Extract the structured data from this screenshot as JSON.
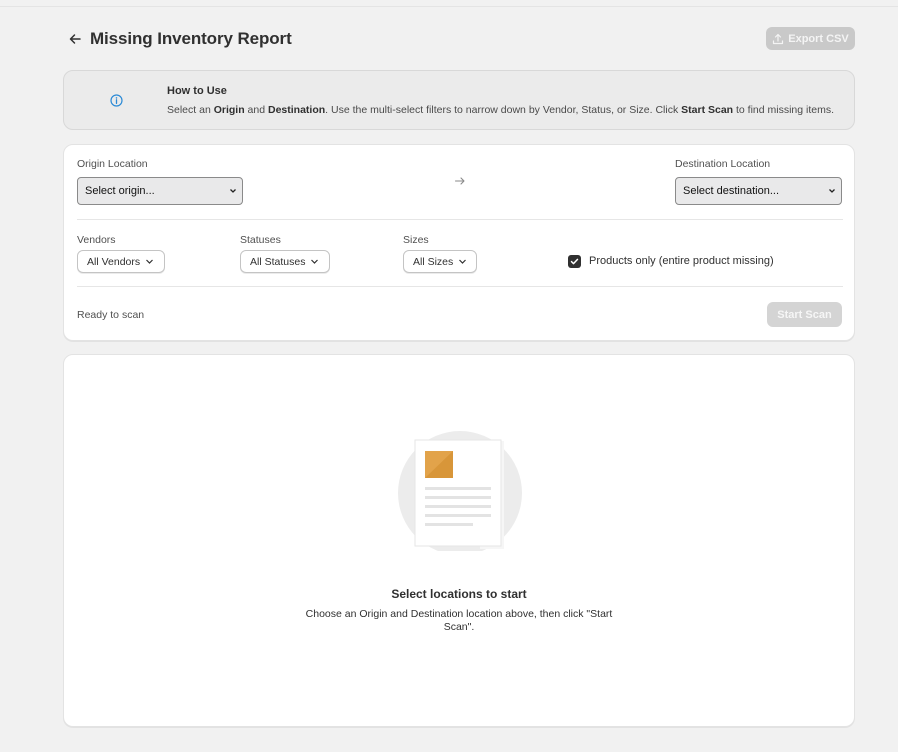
{
  "header": {
    "title": "Missing Inventory Report",
    "export_label": "Export CSV"
  },
  "info": {
    "title": "How to Use",
    "text_parts": [
      "Select an ",
      "Origin",
      " and ",
      "Destination",
      ". Use the multi-select filters to narrow down by Vendor, Status, or Size. Click ",
      "Start Scan",
      " to find missing items."
    ]
  },
  "filters": {
    "origin_label": "Origin Location",
    "origin_value": "Select origin...",
    "destination_label": "Destination Location",
    "destination_value": "Select destination...",
    "vendors_label": "Vendors",
    "vendors_value": "All Vendors",
    "statuses_label": "Statuses",
    "statuses_value": "All Statuses",
    "sizes_label": "Sizes",
    "sizes_value": "All Sizes",
    "products_only_label": "Products only (entire product missing)",
    "products_only_checked": true
  },
  "scan": {
    "status": "Ready to scan",
    "button_label": "Start Scan"
  },
  "empty_state": {
    "title": "Select locations to start",
    "description": "Choose an Origin and Destination location above, then click \"Start Scan\"."
  },
  "colors": {
    "background": "#f1f1f1",
    "info_icon": "#2b8ad6",
    "illustration_accent": "#e2a34a",
    "disabled_button": "#d4d4d4"
  }
}
